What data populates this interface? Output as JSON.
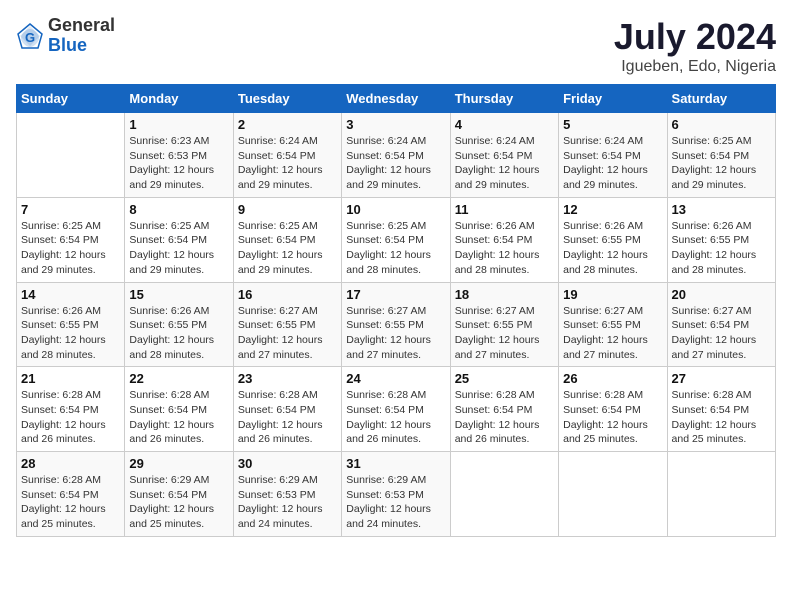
{
  "header": {
    "logo_general": "General",
    "logo_blue": "Blue",
    "month_year": "July 2024",
    "location": "Igueben, Edo, Nigeria"
  },
  "days_of_week": [
    "Sunday",
    "Monday",
    "Tuesday",
    "Wednesday",
    "Thursday",
    "Friday",
    "Saturday"
  ],
  "weeks": [
    [
      {
        "num": "",
        "details": ""
      },
      {
        "num": "1",
        "details": "Sunrise: 6:23 AM\nSunset: 6:53 PM\nDaylight: 12 hours\nand 29 minutes."
      },
      {
        "num": "2",
        "details": "Sunrise: 6:24 AM\nSunset: 6:54 PM\nDaylight: 12 hours\nand 29 minutes."
      },
      {
        "num": "3",
        "details": "Sunrise: 6:24 AM\nSunset: 6:54 PM\nDaylight: 12 hours\nand 29 minutes."
      },
      {
        "num": "4",
        "details": "Sunrise: 6:24 AM\nSunset: 6:54 PM\nDaylight: 12 hours\nand 29 minutes."
      },
      {
        "num": "5",
        "details": "Sunrise: 6:24 AM\nSunset: 6:54 PM\nDaylight: 12 hours\nand 29 minutes."
      },
      {
        "num": "6",
        "details": "Sunrise: 6:25 AM\nSunset: 6:54 PM\nDaylight: 12 hours\nand 29 minutes."
      }
    ],
    [
      {
        "num": "7",
        "details": "Sunrise: 6:25 AM\nSunset: 6:54 PM\nDaylight: 12 hours\nand 29 minutes."
      },
      {
        "num": "8",
        "details": "Sunrise: 6:25 AM\nSunset: 6:54 PM\nDaylight: 12 hours\nand 29 minutes."
      },
      {
        "num": "9",
        "details": "Sunrise: 6:25 AM\nSunset: 6:54 PM\nDaylight: 12 hours\nand 29 minutes."
      },
      {
        "num": "10",
        "details": "Sunrise: 6:25 AM\nSunset: 6:54 PM\nDaylight: 12 hours\nand 28 minutes."
      },
      {
        "num": "11",
        "details": "Sunrise: 6:26 AM\nSunset: 6:54 PM\nDaylight: 12 hours\nand 28 minutes."
      },
      {
        "num": "12",
        "details": "Sunrise: 6:26 AM\nSunset: 6:55 PM\nDaylight: 12 hours\nand 28 minutes."
      },
      {
        "num": "13",
        "details": "Sunrise: 6:26 AM\nSunset: 6:55 PM\nDaylight: 12 hours\nand 28 minutes."
      }
    ],
    [
      {
        "num": "14",
        "details": "Sunrise: 6:26 AM\nSunset: 6:55 PM\nDaylight: 12 hours\nand 28 minutes."
      },
      {
        "num": "15",
        "details": "Sunrise: 6:26 AM\nSunset: 6:55 PM\nDaylight: 12 hours\nand 28 minutes."
      },
      {
        "num": "16",
        "details": "Sunrise: 6:27 AM\nSunset: 6:55 PM\nDaylight: 12 hours\nand 27 minutes."
      },
      {
        "num": "17",
        "details": "Sunrise: 6:27 AM\nSunset: 6:55 PM\nDaylight: 12 hours\nand 27 minutes."
      },
      {
        "num": "18",
        "details": "Sunrise: 6:27 AM\nSunset: 6:55 PM\nDaylight: 12 hours\nand 27 minutes."
      },
      {
        "num": "19",
        "details": "Sunrise: 6:27 AM\nSunset: 6:55 PM\nDaylight: 12 hours\nand 27 minutes."
      },
      {
        "num": "20",
        "details": "Sunrise: 6:27 AM\nSunset: 6:54 PM\nDaylight: 12 hours\nand 27 minutes."
      }
    ],
    [
      {
        "num": "21",
        "details": "Sunrise: 6:28 AM\nSunset: 6:54 PM\nDaylight: 12 hours\nand 26 minutes."
      },
      {
        "num": "22",
        "details": "Sunrise: 6:28 AM\nSunset: 6:54 PM\nDaylight: 12 hours\nand 26 minutes."
      },
      {
        "num": "23",
        "details": "Sunrise: 6:28 AM\nSunset: 6:54 PM\nDaylight: 12 hours\nand 26 minutes."
      },
      {
        "num": "24",
        "details": "Sunrise: 6:28 AM\nSunset: 6:54 PM\nDaylight: 12 hours\nand 26 minutes."
      },
      {
        "num": "25",
        "details": "Sunrise: 6:28 AM\nSunset: 6:54 PM\nDaylight: 12 hours\nand 26 minutes."
      },
      {
        "num": "26",
        "details": "Sunrise: 6:28 AM\nSunset: 6:54 PM\nDaylight: 12 hours\nand 25 minutes."
      },
      {
        "num": "27",
        "details": "Sunrise: 6:28 AM\nSunset: 6:54 PM\nDaylight: 12 hours\nand 25 minutes."
      }
    ],
    [
      {
        "num": "28",
        "details": "Sunrise: 6:28 AM\nSunset: 6:54 PM\nDaylight: 12 hours\nand 25 minutes."
      },
      {
        "num": "29",
        "details": "Sunrise: 6:29 AM\nSunset: 6:54 PM\nDaylight: 12 hours\nand 25 minutes."
      },
      {
        "num": "30",
        "details": "Sunrise: 6:29 AM\nSunset: 6:53 PM\nDaylight: 12 hours\nand 24 minutes."
      },
      {
        "num": "31",
        "details": "Sunrise: 6:29 AM\nSunset: 6:53 PM\nDaylight: 12 hours\nand 24 minutes."
      },
      {
        "num": "",
        "details": ""
      },
      {
        "num": "",
        "details": ""
      },
      {
        "num": "",
        "details": ""
      }
    ]
  ]
}
